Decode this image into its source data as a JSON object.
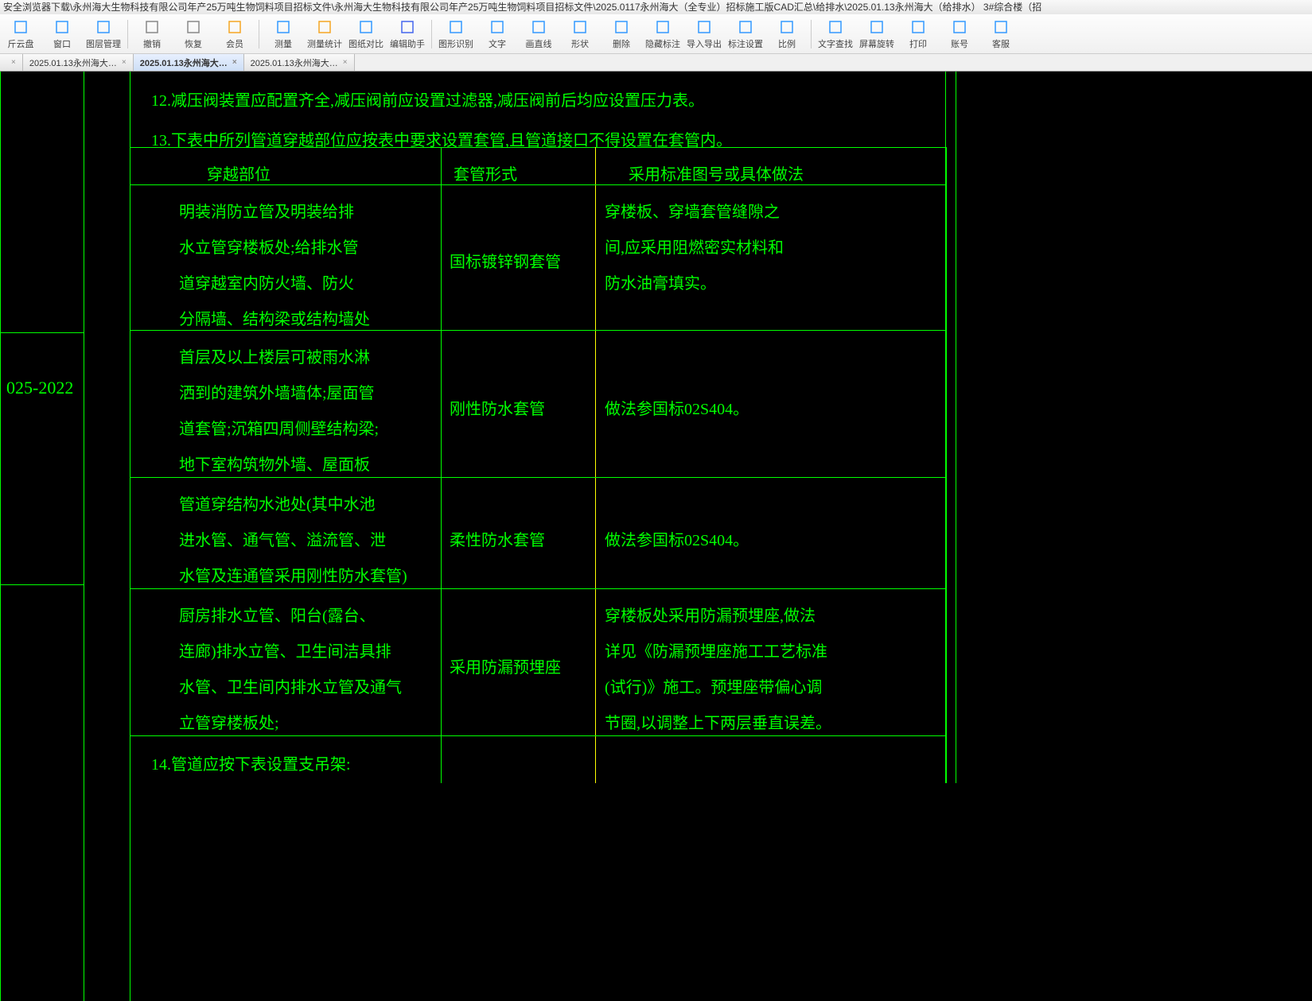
{
  "title": "安全浏览器下载\\永州海大生物科技有限公司年产25万吨生物饲料项目招标文件\\永州海大生物科技有限公司年产25万吨生物饲料项目招标文件\\2025.0117永州海大（全专业）招标施工版CAD汇总\\给排水\\2025.01.13永州海大（给排水） 3#综合楼（招",
  "toolbar": [
    {
      "label": "斤云盘",
      "color": "#3399ff"
    },
    {
      "label": "窗口",
      "color": "#3399ff"
    },
    {
      "label": "图层管理",
      "color": "#3399ff"
    },
    {
      "label": "撤销",
      "color": "#888"
    },
    {
      "label": "恢复",
      "color": "#888"
    },
    {
      "label": "会员",
      "color": "#f5a623"
    },
    {
      "label": "测量",
      "color": "#3399ff"
    },
    {
      "label": "测量统计",
      "color": "#f5a623"
    },
    {
      "label": "图纸对比",
      "color": "#3399ff"
    },
    {
      "label": "编辑助手",
      "color": "#4466ee"
    },
    {
      "label": "图形识别",
      "color": "#3399ff"
    },
    {
      "label": "文字",
      "color": "#3399ff"
    },
    {
      "label": "画直线",
      "color": "#3399ff"
    },
    {
      "label": "形状",
      "color": "#3399ff"
    },
    {
      "label": "删除",
      "color": "#3399ff"
    },
    {
      "label": "隐藏标注",
      "color": "#3399ff"
    },
    {
      "label": "导入导出",
      "color": "#3399ff"
    },
    {
      "label": "标注设置",
      "color": "#3399ff"
    },
    {
      "label": "比例",
      "color": "#3399ff"
    },
    {
      "label": "文字查找",
      "color": "#3399ff"
    },
    {
      "label": "屏幕旋转",
      "color": "#3399ff"
    },
    {
      "label": "打印",
      "color": "#3399ff"
    },
    {
      "label": "账号",
      "color": "#3399ff"
    },
    {
      "label": "客服",
      "color": "#3399ff"
    }
  ],
  "tabs": [
    {
      "label": "2025.01.13永州海大…",
      "active": false
    },
    {
      "label": "2025.01.13永州海大…",
      "active": true
    },
    {
      "label": "2025.01.13永州海大…",
      "active": false
    }
  ],
  "cad": {
    "note12": "12.减压阀装置应配置齐全,减压阀前应设置过滤器,减压阀前后均应设置压力表。",
    "note13": "13.下表中所列管道穿越部位应按表中要求设置套管,且管道接口不得设置在套管内。",
    "note14": "14.管道应按下表设置支吊架:",
    "side_label": "025-2022",
    "headers": {
      "col1": "穿越部位",
      "col2": "套管形式",
      "col3": "采用标准图号或具体做法"
    },
    "rows": [
      {
        "c1": [
          "明装消防立管及明装给排",
          "水立管穿楼板处;给排水管",
          "道穿越室内防火墙、防火",
          "分隔墙、结构梁或结构墙处"
        ],
        "c2": "国标镀锌钢套管",
        "c3": [
          "穿楼板、穿墙套管缝隙之",
          "间,应采用阻燃密实材料和",
          "防水油膏填实。"
        ]
      },
      {
        "c1": [
          "首层及以上楼层可被雨水淋",
          "洒到的建筑外墙墙体;屋面管",
          "道套管;沉箱四周侧壁结构梁;",
          "地下室构筑物外墙、屋面板"
        ],
        "c2": "刚性防水套管",
        "c3": [
          "做法参国标02S404。"
        ]
      },
      {
        "c1": [
          "管道穿结构水池处(其中水池",
          "进水管、通气管、溢流管、泄",
          "水管及连通管采用刚性防水套管)"
        ],
        "c2": "柔性防水套管",
        "c3": [
          "做法参国标02S404。"
        ]
      },
      {
        "c1": [
          "厨房排水立管、阳台(露台、",
          "连廊)排水立管、卫生间洁具排",
          "水管、卫生间内排水立管及通气",
          "立管穿楼板处;"
        ],
        "c2": "采用防漏预埋座",
        "c3": [
          "穿楼板处采用防漏预埋座,做法",
          "详见《防漏预埋座施工工艺标准",
          "(试行)》施工。预埋座带偏心调",
          "节圈,以调整上下两层垂直误差。"
        ]
      }
    ]
  }
}
